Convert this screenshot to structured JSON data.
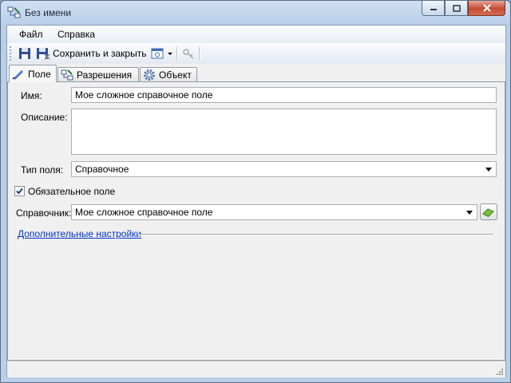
{
  "window": {
    "title": "Без имени",
    "icon": "form-icon"
  },
  "menu": {
    "file": "Файл",
    "help": "Справка"
  },
  "toolbar": {
    "save_close_label": "Сохранить и закрыть"
  },
  "tabs": [
    {
      "label": "Поле",
      "icon": "field-icon",
      "active": true
    },
    {
      "label": "Разрешения",
      "icon": "permissions-icon",
      "active": false
    },
    {
      "label": "Объект",
      "icon": "gear-icon",
      "active": false
    }
  ],
  "form": {
    "name_label": "Имя:",
    "name_value": "Мое сложное справочное поле",
    "description_label": "Описание:",
    "description_value": "",
    "field_type_label": "Тип поля:",
    "field_type_value": "Справочное",
    "required_label": "Обязательное поле",
    "required_checked": true,
    "reference_label": "Справочник:",
    "reference_value": "Мое сложное справочное поле",
    "advanced_link": "Дополнительные настройки"
  },
  "colors": {
    "link": "#0033cc",
    "close_button": "#c64b34",
    "window_frame": "#b9cfe8"
  }
}
